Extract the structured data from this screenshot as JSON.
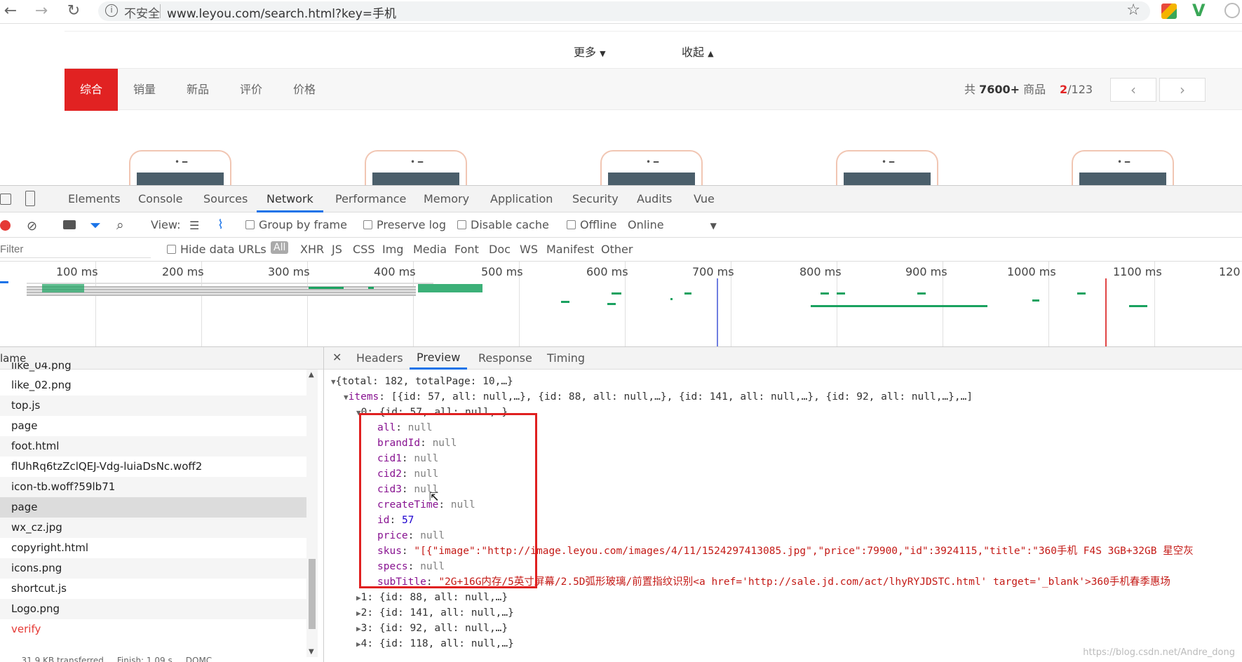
{
  "browser": {
    "security_label": "不安全",
    "url": "www.leyou.com/search.html?key=手机"
  },
  "site": {
    "more_label": "更多",
    "collapse_label": "收起",
    "sort_tabs": [
      "综合",
      "销量",
      "新品",
      "评价",
      "价格"
    ],
    "total_prefix": "共",
    "total_count": "7600+",
    "total_suffix": "商品",
    "page_current": "2",
    "page_total": "/123"
  },
  "devtools": {
    "tabs": [
      "Elements",
      "Console",
      "Sources",
      "Network",
      "Performance",
      "Memory",
      "Application",
      "Security",
      "Audits",
      "Vue"
    ],
    "active_tab": "Network",
    "toolbar": {
      "view_label": "View:",
      "group_by_frame": "Group by frame",
      "preserve_log": "Preserve log",
      "disable_cache": "Disable cache",
      "offline": "Offline",
      "online": "Online"
    },
    "filter": {
      "placeholder": "Filter",
      "hide_data_urls": "Hide data URLs",
      "types": [
        "All",
        "XHR",
        "JS",
        "CSS",
        "Img",
        "Media",
        "Font",
        "Doc",
        "WS",
        "Manifest",
        "Other"
      ]
    },
    "timeline_ticks": [
      "100 ms",
      "200 ms",
      "300 ms",
      "400 ms",
      "500 ms",
      "600 ms",
      "700 ms",
      "800 ms",
      "900 ms",
      "1000 ms",
      "1100 ms",
      "120"
    ],
    "list_header": "lame",
    "requests": [
      "like_04.png",
      "like_02.png",
      "top.js",
      "page",
      "foot.html",
      "flUhRq6tzZclQEJ-Vdg-luiaDsNc.woff2",
      "icon-tb.woff?59lb71",
      "page",
      "wx_cz.jpg",
      "copyright.html",
      "icons.png",
      "shortcut.js",
      "Logo.png",
      "verify"
    ],
    "status_line": "... ... 31.9 KB transferred ... Finish: 1.09 s ... DOMC",
    "detail_tabs": [
      "Headers",
      "Preview",
      "Response",
      "Timing"
    ],
    "active_detail_tab": "Preview",
    "preview": {
      "root": "{total: 182, totalPage: 10,…}",
      "items_key": "items",
      "items_summary": "[{id: 57, all: null,…}, {id: 88, all: null,…}, {id: 141, all: null,…}, {id: 92, all: null,…},…]",
      "item0": "0: {id: 57, all: null,…}",
      "fields": [
        {
          "key": "all",
          "value": "null",
          "type": "null"
        },
        {
          "key": "brandId",
          "value": "null",
          "type": "null"
        },
        {
          "key": "cid1",
          "value": "null",
          "type": "null"
        },
        {
          "key": "cid2",
          "value": "null",
          "type": "null"
        },
        {
          "key": "cid3",
          "value": "null",
          "type": "null"
        },
        {
          "key": "createTime",
          "value": "null",
          "type": "null"
        },
        {
          "key": "id",
          "value": "57",
          "type": "num"
        },
        {
          "key": "price",
          "value": "null",
          "type": "null"
        },
        {
          "key": "skus",
          "value": "\"[{\"image\":\"http://image.leyou.com/images/4/11/1524297413085.jpg\",\"price\":79900,\"id\":3924115,\"title\":\"360手机 F4S 3GB+32GB 星空灰",
          "type": "str"
        },
        {
          "key": "specs",
          "value": "null",
          "type": "null"
        },
        {
          "key": "subTitle",
          "value": "\"2G+16G内存/5英寸屏幕/2.5D弧形玻璃/前置指纹识别<a href='http://sale.jd.com/act/lhyRYJDSTC.html' target='_blank'>360手机春季惠场",
          "type": "str"
        }
      ],
      "collapsed": [
        "1: {id: 88, all: null,…}",
        "2: {id: 141, all: null,…}",
        "3: {id: 92, all: null,…}",
        "4: {id: 118, all: null,…}"
      ]
    }
  },
  "watermark": "https://blog.csdn.net/Andre_dong"
}
